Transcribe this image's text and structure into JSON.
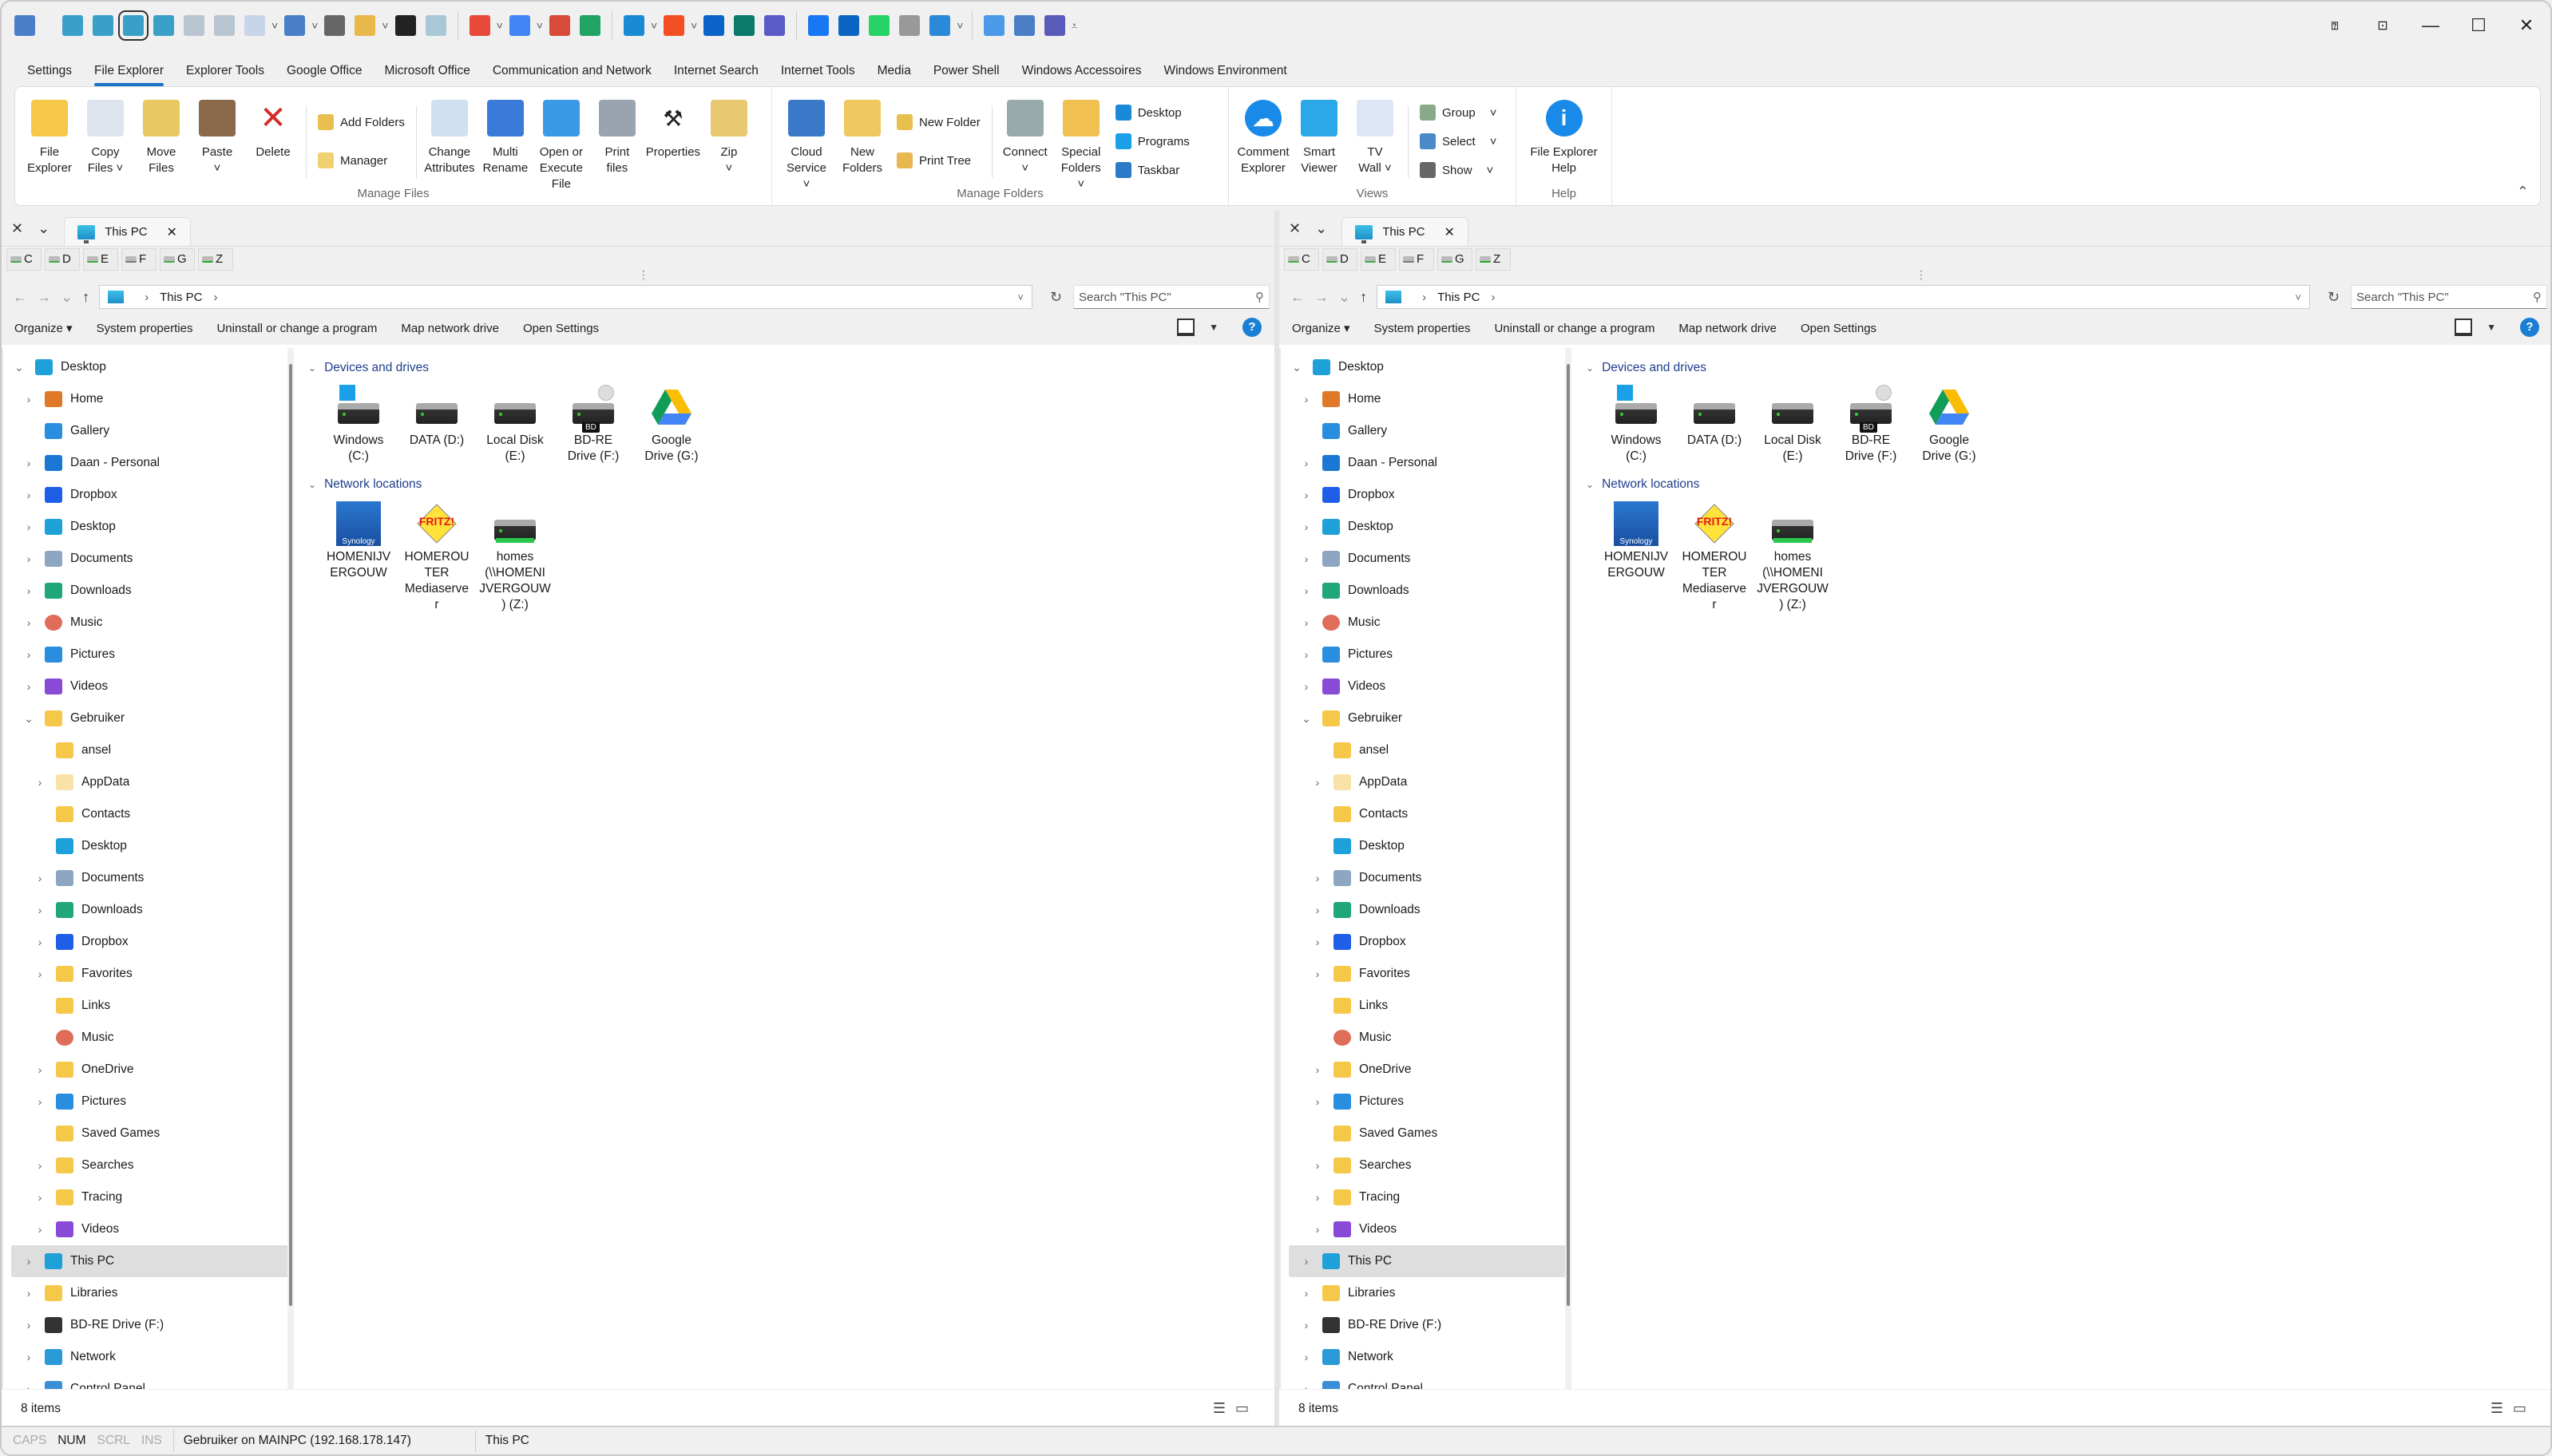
{
  "quick_access_toolbar": {
    "icons": [
      "app-globe-icon",
      "compare-right-icon",
      "compare-left-icon",
      "sync-icon",
      "sync-both-icon",
      "split-horizontal-icon",
      "split-vertical-icon",
      "grid-icon",
      "cloud-icon",
      "print-icon",
      "special-folder-icon",
      "console-icon",
      "network-tree-icon",
      "chrome-icon",
      "google-icon",
      "gmail-icon",
      "google-drive-icon",
      "edge-icon",
      "microsoft-icon",
      "outlook-icon",
      "sharepoint-icon",
      "teams-icon",
      "facebook-icon",
      "linkedin-icon",
      "whatsapp-icon",
      "phone-icon",
      "store-icon",
      "internet-time-icon",
      "cloud-service-icon",
      "door-icon"
    ]
  },
  "window_controls": [
    "help-icon",
    "restore-icon",
    "minimize-icon",
    "maximize-icon",
    "close-icon"
  ],
  "ribbon_tabs": [
    "Settings",
    "File Explorer",
    "Explorer Tools",
    "Google Office",
    "Microsoft Office",
    "Communication and Network",
    "Internet Search",
    "Internet Tools",
    "Media",
    "Power Shell",
    "Windows Accessoires",
    "Windows Environment"
  ],
  "active_ribbon_tab": "File Explorer",
  "ribbon": {
    "manage_files": {
      "label": "Manage Files",
      "big": [
        {
          "label": "File\nExplorer",
          "icon": "folder-icon"
        },
        {
          "label": "Copy\nFiles ˅",
          "icon": "copy-icon"
        },
        {
          "label": "Move\nFiles",
          "icon": "move-icon"
        },
        {
          "label": "Paste\n˅",
          "icon": "clipboard-icon"
        },
        {
          "label": "Delete",
          "icon": "delete-icon"
        }
      ],
      "small": [
        {
          "label": "Add Folders",
          "icon": "add-folder-icon"
        },
        {
          "label": "Manager",
          "icon": "manager-icon"
        }
      ],
      "big2": [
        {
          "label": "Change\nAttributes",
          "icon": "attributes-icon"
        },
        {
          "label": "Multi\nRename",
          "icon": "rename-icon"
        },
        {
          "label": "Open or\nExecute File",
          "icon": "execute-icon"
        },
        {
          "label": "Print\nfiles",
          "icon": "printer-icon"
        },
        {
          "label": "Properties",
          "icon": "wrench-icon"
        },
        {
          "label": "Zip\n˅",
          "icon": "zip-icon"
        }
      ]
    },
    "manage_folders": {
      "label": "Manage Folders",
      "big": [
        {
          "label": "Cloud\nService ˅",
          "icon": "cloud-globe-icon"
        },
        {
          "label": "New\nFolders",
          "icon": "folder-tree-icon"
        }
      ],
      "small": [
        {
          "label": "New Folder",
          "icon": "new-folder-icon"
        },
        {
          "label": "Print Tree",
          "icon": "print-tree-icon"
        }
      ],
      "big2": [
        {
          "label": "Connect\n˅",
          "icon": "network-drive-icon"
        },
        {
          "label": "Special\nFolders ˅",
          "icon": "special-folders-icon"
        }
      ],
      "small2": [
        {
          "label": "Desktop",
          "icon": "desktop-icon"
        },
        {
          "label": "Programs",
          "icon": "windows-icon"
        },
        {
          "label": "Taskbar",
          "icon": "taskbar-icon"
        }
      ]
    },
    "views": {
      "label": "Views",
      "big": [
        {
          "label": "Comment\nExplorer",
          "icon": "comment-cloud-icon"
        },
        {
          "label": "Smart\nViewer",
          "icon": "image-viewer-icon"
        },
        {
          "label": "TV\nWall ˅",
          "icon": "tv-wall-icon"
        }
      ],
      "small": [
        {
          "label": "Group",
          "icon": "group-icon"
        },
        {
          "label": "Select",
          "icon": "select-icon"
        },
        {
          "label": "Show",
          "icon": "show-icon"
        }
      ]
    },
    "help": {
      "label": "Help",
      "big": [
        {
          "label": "File Explorer\nHelp",
          "icon": "info-icon"
        }
      ]
    }
  },
  "pane": {
    "tab_label": "This PC",
    "drives": [
      "C",
      "D",
      "E",
      "F",
      "G",
      "Z"
    ],
    "address": {
      "crumbs": [
        "This PC"
      ]
    },
    "search_placeholder": "Search \"This PC\"",
    "commands": [
      "Organize ▾",
      "System properties",
      "Uninstall or change a program",
      "Map network drive",
      "Open Settings"
    ],
    "tree": [
      {
        "label": "Desktop",
        "level": 0,
        "arrow": "v",
        "icon": "desktop",
        "color": "#1ea0d8"
      },
      {
        "label": "Home",
        "level": 1,
        "arrow": ">",
        "icon": "home",
        "color": "#e0782a"
      },
      {
        "label": "Gallery",
        "level": 1,
        "arrow": "",
        "icon": "gallery",
        "color": "#2a8ee0"
      },
      {
        "label": "Daan - Personal",
        "level": 1,
        "arrow": ">",
        "icon": "onedrive",
        "color": "#1a78d4"
      },
      {
        "label": "Dropbox",
        "level": 1,
        "arrow": ">",
        "icon": "dropbox",
        "color": "#1f5fe8"
      },
      {
        "label": "Desktop",
        "level": 1,
        "arrow": ">",
        "icon": "desktop",
        "color": "#1ea0d8"
      },
      {
        "label": "Documents",
        "level": 1,
        "arrow": ">",
        "icon": "documents",
        "color": "#8ea6c2"
      },
      {
        "label": "Downloads",
        "level": 1,
        "arrow": ">",
        "icon": "downloads",
        "color": "#1fa67a"
      },
      {
        "label": "Music",
        "level": 1,
        "arrow": ">",
        "icon": "music",
        "color": "#e06c5a"
      },
      {
        "label": "Pictures",
        "level": 1,
        "arrow": ">",
        "icon": "pictures",
        "color": "#2a8ee0"
      },
      {
        "label": "Videos",
        "level": 1,
        "arrow": ">",
        "icon": "videos",
        "color": "#8a4ad8"
      },
      {
        "label": "Gebruiker",
        "level": 1,
        "arrow": "v",
        "icon": "folder",
        "color": "#f6c84a"
      },
      {
        "label": "ansel",
        "level": 2,
        "arrow": "",
        "icon": "folder",
        "color": "#f6c84a"
      },
      {
        "label": "AppData",
        "level": 2,
        "arrow": ">",
        "icon": "folder",
        "color": "#f8e2a8"
      },
      {
        "label": "Contacts",
        "level": 2,
        "arrow": "",
        "icon": "folder",
        "color": "#f6c84a"
      },
      {
        "label": "Desktop",
        "level": 2,
        "arrow": "",
        "icon": "desktop",
        "color": "#1ea0d8"
      },
      {
        "label": "Documents",
        "level": 2,
        "arrow": ">",
        "icon": "documents",
        "color": "#8ea6c2"
      },
      {
        "label": "Downloads",
        "level": 2,
        "arrow": ">",
        "icon": "downloads",
        "color": "#1fa67a"
      },
      {
        "label": "Dropbox",
        "level": 2,
        "arrow": ">",
        "icon": "dropbox",
        "color": "#1f5fe8"
      },
      {
        "label": "Favorites",
        "level": 2,
        "arrow": ">",
        "icon": "folder",
        "color": "#f6c84a"
      },
      {
        "label": "Links",
        "level": 2,
        "arrow": "",
        "icon": "folder",
        "color": "#f6c84a"
      },
      {
        "label": "Music",
        "level": 2,
        "arrow": "",
        "icon": "music",
        "color": "#e06c5a"
      },
      {
        "label": "OneDrive",
        "level": 2,
        "arrow": ">",
        "icon": "folder",
        "color": "#f6c84a"
      },
      {
        "label": "Pictures",
        "level": 2,
        "arrow": ">",
        "icon": "pictures",
        "color": "#2a8ee0"
      },
      {
        "label": "Saved Games",
        "level": 2,
        "arrow": "",
        "icon": "folder",
        "color": "#f6c84a"
      },
      {
        "label": "Searches",
        "level": 2,
        "arrow": ">",
        "icon": "folder",
        "color": "#f6c84a"
      },
      {
        "label": "Tracing",
        "level": 2,
        "arrow": ">",
        "icon": "folder",
        "color": "#f6c84a"
      },
      {
        "label": "Videos",
        "level": 2,
        "arrow": ">",
        "icon": "videos",
        "color": "#8a4ad8"
      },
      {
        "label": "This PC",
        "level": 1,
        "arrow": ">",
        "icon": "this-pc",
        "color": "#1ea0d8",
        "selected": true
      },
      {
        "label": "Libraries",
        "level": 1,
        "arrow": ">",
        "icon": "libraries",
        "color": "#f6c84a"
      },
      {
        "label": "BD-RE Drive (F:)",
        "level": 1,
        "arrow": ">",
        "icon": "bd-drive",
        "color": "#333333"
      },
      {
        "label": "Network",
        "level": 1,
        "arrow": ">",
        "icon": "network",
        "color": "#2a9ad8"
      },
      {
        "label": "Control Panel",
        "level": 1,
        "arrow": ">",
        "icon": "control-panel",
        "color": "#3a8ed8"
      }
    ],
    "sections": [
      {
        "title": "Devices and drives",
        "items": [
          {
            "label": "Windows\n(C:)",
            "icon": "windows-drive"
          },
          {
            "label": "DATA (D:)",
            "icon": "hard-drive"
          },
          {
            "label": "Local Disk\n(E:)",
            "icon": "hard-drive"
          },
          {
            "label": "BD-RE\nDrive (F:)",
            "icon": "bd-drive"
          },
          {
            "label": "Google\nDrive (G:)",
            "icon": "google-drive"
          }
        ]
      },
      {
        "title": "Network locations",
        "items": [
          {
            "label": "HOMENIJV\nERGOUW",
            "icon": "synology"
          },
          {
            "label": "HOMEROU\nTER\nMediaserve\nr",
            "icon": "fritz"
          },
          {
            "label": "homes\n(\\\\HOMENI\nJVERGOUW\n) (Z:)",
            "icon": "network-drive"
          }
        ]
      }
    ],
    "item_count": "8 items"
  },
  "statusbar": {
    "keys": [
      {
        "label": "CAPS",
        "on": false
      },
      {
        "label": "NUM",
        "on": true
      },
      {
        "label": "SCRL",
        "on": false
      },
      {
        "label": "INS",
        "on": false
      }
    ],
    "user": "Gebruiker on MAINPC (192.168.178.147)",
    "location": "This PC"
  }
}
